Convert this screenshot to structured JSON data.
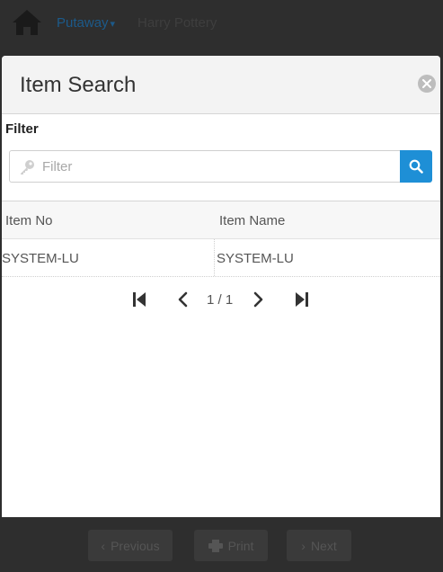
{
  "app": {
    "nav_menu": "Putaway",
    "user_name": "Harry Pottery"
  },
  "footer": {
    "previous_label": "Previous",
    "print_label": "Print",
    "next_label": "Next"
  },
  "modal": {
    "title": "Item Search",
    "filter_label": "Filter",
    "filter_placeholder": "Filter",
    "filter_value": "",
    "columns": [
      "Item No",
      "Item Name"
    ],
    "rows": [
      {
        "item_no": "SYSTEM-LU",
        "item_name": "SYSTEM-LU"
      }
    ],
    "pager": {
      "current_page": "1",
      "total_pages": "1",
      "text": "1 / 1"
    }
  },
  "colors": {
    "accent": "#1e8fd6",
    "overlay": "#2e2e2e",
    "header_bg": "#f3f3f3"
  },
  "icons": [
    "home-icon",
    "chevron-down-icon",
    "close-icon",
    "key-icon",
    "search-icon",
    "first-page-icon",
    "prev-page-icon",
    "next-page-icon",
    "last-page-icon",
    "print-icon"
  ]
}
